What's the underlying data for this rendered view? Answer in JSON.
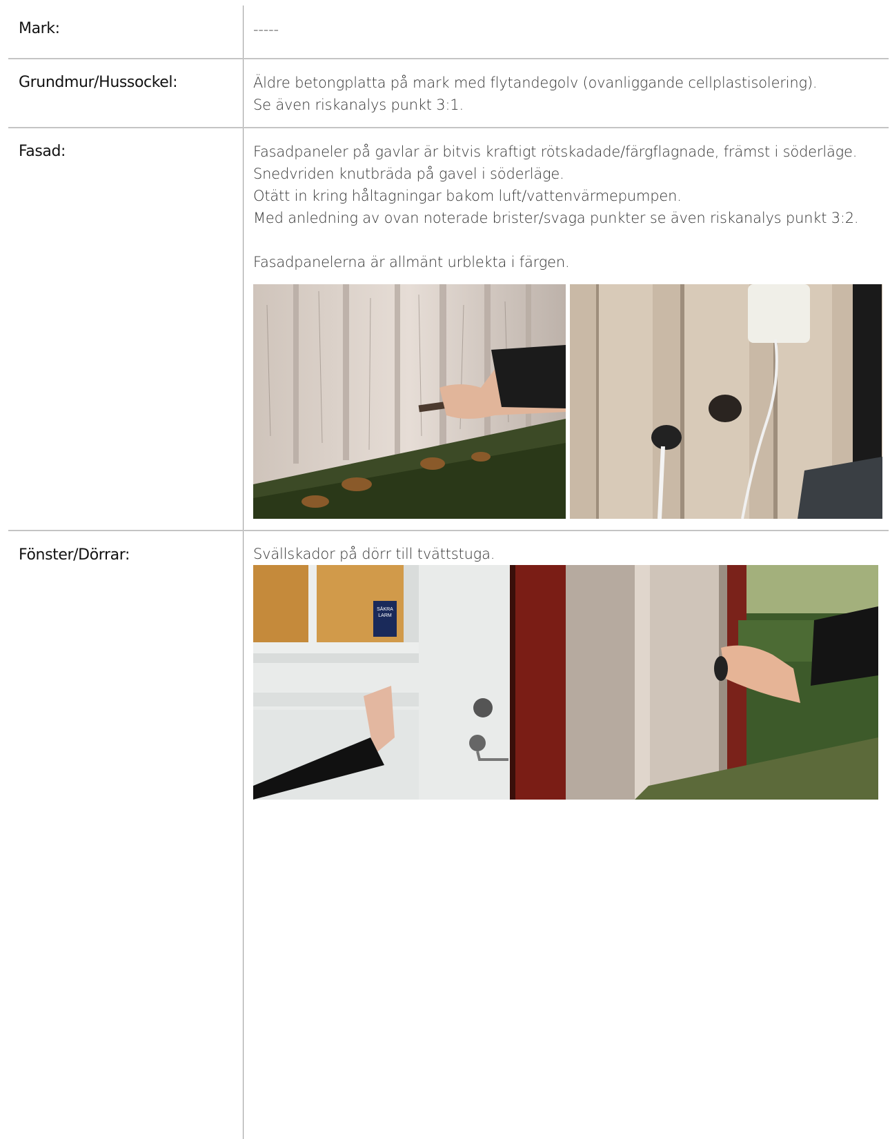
{
  "rows": [
    {
      "label": "Mark:",
      "lines": [
        "-----"
      ]
    },
    {
      "label": "Grundmur/Hussockel:",
      "lines": [
        "Äldre betongplatta på mark med flytandegolv (ovanliggande cellplastisolering).",
        "Se även riskanalys punkt 3:1."
      ]
    },
    {
      "label": "Fasad:",
      "lines": [
        "Fasadpaneler på gavlar är bitvis kraftigt rötskadade/färgflagnade, främst i söderläge.",
        "Snedvriden knutbräda på gavel i söderläge.",
        "Otätt in kring håltagningar bakom luft/vattenvärmepumpen.",
        "Med anledning av ovan noterade brister/svaga punkter se även riskanalys punkt 3:2.",
        "",
        "Fasadpanelerna är allmänt urblekta i färgen."
      ]
    },
    {
      "label": "Fönster/Dörrar:",
      "lines": [
        "Svällskador på dörr till tvättstuga."
      ]
    }
  ],
  "sticker": {
    "line1": "SÄKRA",
    "line2": "LARM"
  }
}
